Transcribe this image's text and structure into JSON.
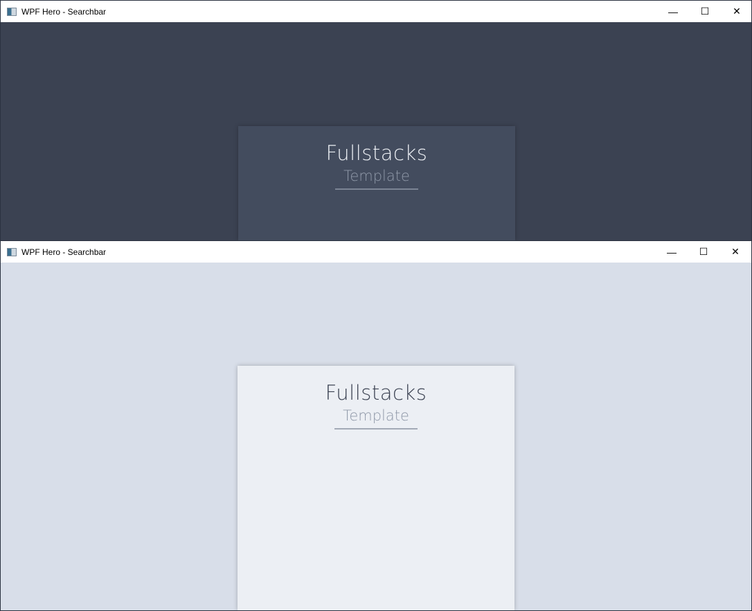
{
  "windows": [
    {
      "title": "WPF Hero - Searchbar",
      "theme": "dark",
      "card": {
        "title": "Fullstacks",
        "subtitle": "Template"
      },
      "colors": {
        "background": "#3b4252",
        "card": "#434c5e",
        "title": "#eceff4",
        "subtitle": "#8f98a8",
        "line": "#7b8494"
      }
    },
    {
      "title": "WPF Hero - Searchbar",
      "theme": "light",
      "card": {
        "title": "Fullstacks",
        "subtitle": "Template"
      },
      "colors": {
        "background": "#d8dee9",
        "card": "#eceff4",
        "title": "#3b4252",
        "subtitle": "#8f98a8",
        "line": "#a3aab6"
      }
    }
  ],
  "controls": {
    "minimize": "—",
    "maximize": "☐",
    "close": "✕"
  }
}
